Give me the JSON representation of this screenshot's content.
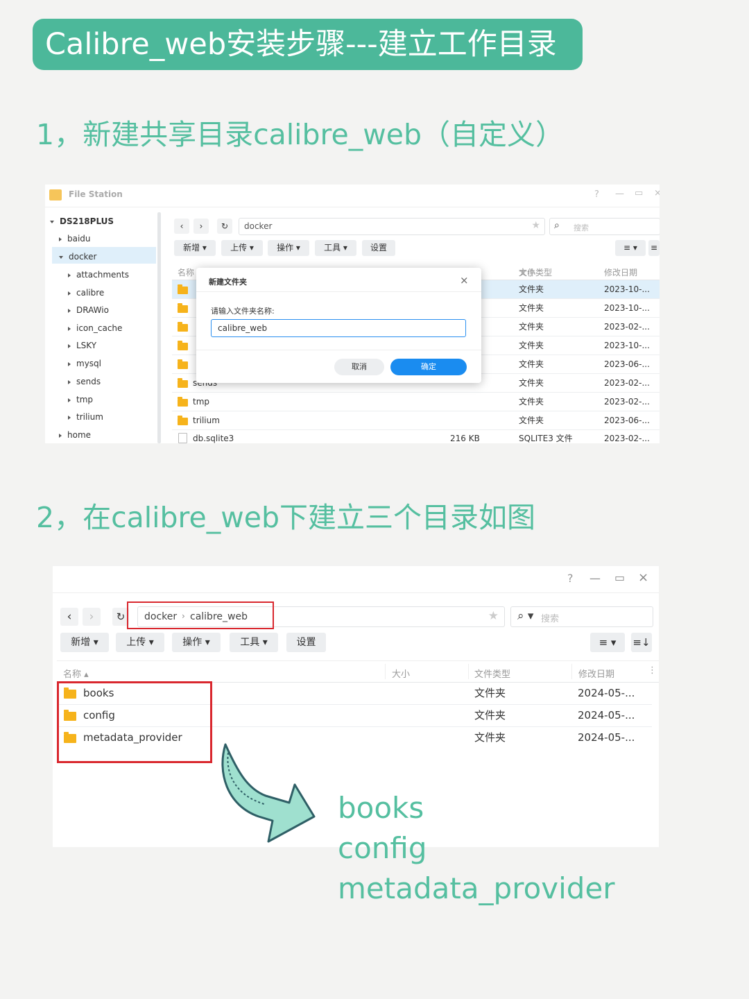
{
  "banner": {
    "title": "Calibre_web安装步骤---建立工作目录"
  },
  "steps": {
    "step1": "1，新建共享目录calibre_web（自定义）",
    "step2": "2，在calibre_web下建立三个目录如图"
  },
  "shot1": {
    "app_title": "File Station",
    "window_controls": [
      "?",
      "—",
      "▭",
      "×"
    ],
    "tree": {
      "root": "DS218PLUS",
      "items": [
        "baidu",
        "docker",
        "attachments",
        "calibre",
        "DRAWio",
        "icon_cache",
        "LSKY",
        "mysql",
        "sends",
        "tmp",
        "trilium",
        "home"
      ]
    },
    "path": "docker",
    "search_placeholder": "搜索",
    "toolbar": [
      "新增",
      "上传",
      "操作",
      "工具",
      "设置"
    ],
    "headers": {
      "name": "名称",
      "size": "大小",
      "type": "文件类型",
      "date": "修改日期"
    },
    "rows": [
      {
        "name": "",
        "size": "",
        "type": "文件夹",
        "date": "2023-10-..."
      },
      {
        "name": "",
        "size": "",
        "type": "文件夹",
        "date": "2023-10-..."
      },
      {
        "name": "",
        "size": "",
        "type": "文件夹",
        "date": "2023-02-..."
      },
      {
        "name": "",
        "size": "",
        "type": "文件夹",
        "date": "2023-10-..."
      },
      {
        "name": "",
        "size": "",
        "type": "文件夹",
        "date": "2023-06-..."
      },
      {
        "name": "sends",
        "size": "",
        "type": "文件夹",
        "date": "2023-02-..."
      },
      {
        "name": "tmp",
        "size": "",
        "type": "文件夹",
        "date": "2023-02-..."
      },
      {
        "name": "trilium",
        "size": "",
        "type": "文件夹",
        "date": "2023-06-..."
      },
      {
        "name": "db.sqlite3",
        "size": "216 KB",
        "type": "SQLITE3 文件",
        "date": "2023-02-..."
      }
    ],
    "dialog": {
      "title": "新建文件夹",
      "prompt": "请输入文件夹名称:",
      "value": "calibre_web",
      "cancel": "取消",
      "ok": "确定"
    }
  },
  "shot2": {
    "window_controls": [
      "?",
      "—",
      "▭",
      "×"
    ],
    "breadcrumb": [
      "docker",
      "calibre_web"
    ],
    "search_placeholder": "搜索",
    "toolbar": [
      "新增",
      "上传",
      "操作",
      "工具",
      "设置"
    ],
    "headers": {
      "name": "名称",
      "size": "大小",
      "type": "文件类型",
      "date": "修改日期"
    },
    "rows": [
      {
        "name": "books",
        "type": "文件夹",
        "date": "2024-05-..."
      },
      {
        "name": "config",
        "type": "文件夹",
        "date": "2024-05-..."
      },
      {
        "name": "metadata_provider",
        "type": "文件夹",
        "date": "2024-05-..."
      }
    ]
  },
  "result_list": [
    "books",
    "config",
    "metadata_provider"
  ],
  "colors": {
    "accent": "#4cb89a",
    "step_text": "#55bfa0",
    "highlight": "#d9272e",
    "primary_button": "#1a8cf0"
  }
}
